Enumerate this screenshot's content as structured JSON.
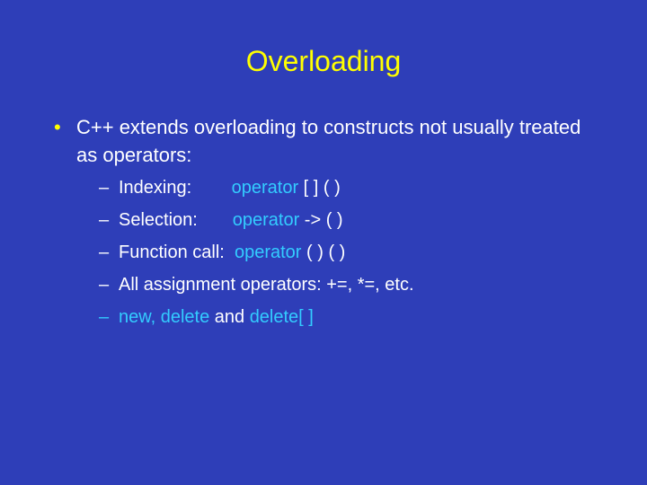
{
  "title": "Overloading",
  "main_bullet": "C++ extends overloading to constructs not usually treated as operators:",
  "indexing_label": "Indexing:        ",
  "operator_keyword": "operator",
  "indexing_syntax": " [ ] ( )",
  "selection_label": "Selection:       ",
  "selection_syntax": " -> ( )",
  "function_label": "Function call:  ",
  "function_syntax": " ( ) ( )",
  "assignment_text": "All assignment operators: +=, *=, etc.",
  "new_delete_1": "new, delete",
  "and_text": " and ",
  "new_delete_2": "delete[ ]"
}
